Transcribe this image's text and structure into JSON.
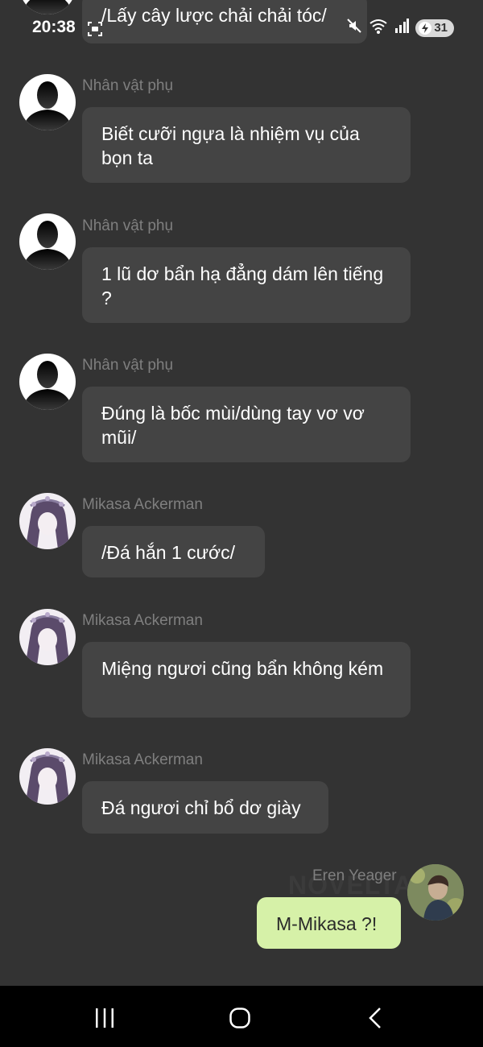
{
  "status_bar": {
    "time": "20:38",
    "battery": "31",
    "icons": [
      "screenshot-icon",
      "mute-icon",
      "wifi-icon",
      "signal-icon",
      "battery-charging-icon"
    ]
  },
  "messages": [
    {
      "sender": "",
      "text": "/Lấy cây lược chải chải tóc/",
      "avatar": "silhouette-avatar",
      "side": "left"
    },
    {
      "sender": "Nhân vật phụ",
      "text": "Biết cưỡi ngựa là nhiệm vụ của bọn ta",
      "avatar": "silhouette-avatar",
      "side": "left"
    },
    {
      "sender": "Nhân vật phụ",
      "text": "1 lũ dơ bẩn hạ đẳng dám lên tiếng ?",
      "avatar": "silhouette-avatar",
      "side": "left"
    },
    {
      "sender": "Nhân vật phụ",
      "text": "Đúng là bốc mùi/dùng tay vơ vơ mũi/",
      "avatar": "silhouette-avatar",
      "side": "left"
    },
    {
      "sender": "Mikasa Ackerman",
      "text": "/Đá hắn 1 cước/",
      "avatar": "mikasa-avatar",
      "side": "left"
    },
    {
      "sender": "Mikasa Ackerman",
      "text": "Miệng ngươi cũng bẩn không kém",
      "avatar": "mikasa-avatar",
      "side": "left"
    },
    {
      "sender": "Mikasa Ackerman",
      "text": "Đá ngươi chỉ bổ dơ giày",
      "avatar": "mikasa-avatar",
      "side": "left"
    },
    {
      "sender": "Eren Yeager",
      "text": "M-Mikasa ?!",
      "avatar": "eren-avatar",
      "side": "right"
    }
  ],
  "watermark": "NOVELTALK",
  "colors": {
    "background": "#333333",
    "bubble": "#444444",
    "user_bubble": "#d6f1a8",
    "sender_name": "#7f7f7f",
    "nav_bar": "#000000"
  },
  "nav_bar": {
    "buttons": [
      "recent-apps-icon",
      "home-icon",
      "back-icon"
    ]
  }
}
